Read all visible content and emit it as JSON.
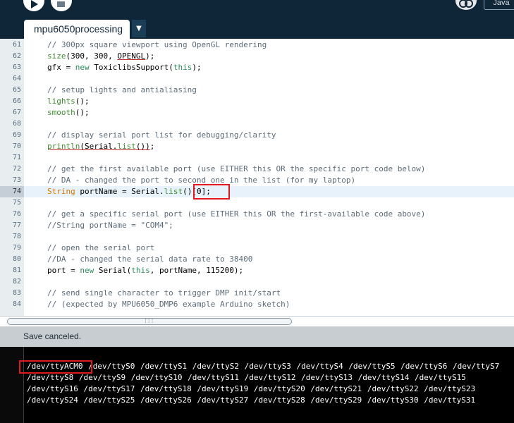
{
  "toolbar": {
    "mode_label": "Java"
  },
  "tab": {
    "label": "mpu6050processing",
    "menu_arrow": "▼"
  },
  "editor": {
    "lines": [
      {
        "num": "61",
        "text": "// 300px square viewport using OpenGL rendering"
      },
      {
        "num": "62",
        "text": "size(300, 300, OPENGL);"
      },
      {
        "num": "63",
        "text": "gfx = new ToxiclibsSupport(this);"
      },
      {
        "num": "64",
        "text": ""
      },
      {
        "num": "65",
        "text": "// setup lights and antialiasing"
      },
      {
        "num": "66",
        "text": "lights();"
      },
      {
        "num": "67",
        "text": "smooth();"
      },
      {
        "num": "68",
        "text": ""
      },
      {
        "num": "69",
        "text": "// display serial port list for debugging/clarity"
      },
      {
        "num": "70",
        "text": "println(Serial.list());"
      },
      {
        "num": "71",
        "text": ""
      },
      {
        "num": "72",
        "text": "// get the first available port (use EITHER this OR the specific port code below)"
      },
      {
        "num": "73",
        "text": "// DA - changed the port to second one in the list (for my laptop)"
      },
      {
        "num": "74",
        "text": "String portName = Serial.list()[0];"
      },
      {
        "num": "75",
        "text": ""
      },
      {
        "num": "76",
        "text": "// get a specific serial port (use EITHER this OR the first-available code above)"
      },
      {
        "num": "77",
        "text": "//String portName = \"COM4\";"
      },
      {
        "num": "78",
        "text": ""
      },
      {
        "num": "79",
        "text": "// open the serial port"
      },
      {
        "num": "80",
        "text": "//DA - changed the serial data rate to 38400"
      },
      {
        "num": "81",
        "text": "port = new Serial(this, portName, 115200);"
      },
      {
        "num": "82",
        "text": ""
      },
      {
        "num": "83",
        "text": "// send single character to trigger DMP init/start"
      },
      {
        "num": "84",
        "text": "// (expected by MPU6050_DMP6 example Arduino sketch)"
      }
    ],
    "active_line": "74"
  },
  "status": {
    "message": "Save canceled."
  },
  "console": {
    "output": "/dev/ttyACM0 /dev/ttyS0 /dev/ttyS1 /dev/ttyS2 /dev/ttyS3 /dev/ttyS4 /dev/ttyS5 /dev/ttyS6 /dev/ttyS7 /dev/ttyS8 /dev/ttyS9 /dev/ttyS10 /dev/ttyS11 /dev/ttyS12 /dev/ttyS13 /dev/ttyS14 /dev/ttyS15 /dev/ttyS16 /dev/ttyS17 /dev/ttyS18 /dev/ttyS19 /dev/ttyS20 /dev/ttyS21 /dev/ttyS22 /dev/ttyS23 /dev/ttyS24 /dev/ttyS25 /dev/ttyS26 /dev/ttyS27 /dev/ttyS28 /dev/ttyS29 /dev/ttyS30 /dev/ttyS31"
  },
  "icons": {
    "run": "play-icon",
    "stop": "stop-icon",
    "debug": "debug-icon",
    "tab_menu": "chevron-down-icon"
  },
  "colors": {
    "background": "#0f2638",
    "highlight_box": "#e0191f",
    "comment": "#5b6b78",
    "function": "#3e8a2e",
    "type": "#d07500"
  }
}
